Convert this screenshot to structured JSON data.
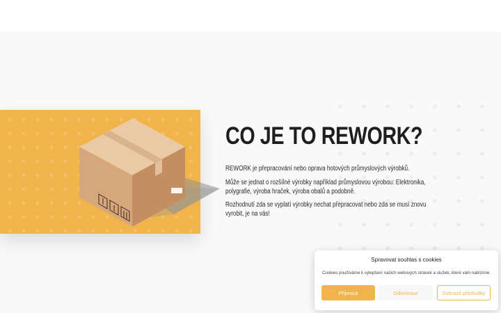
{
  "hero": {
    "heading": "CO JE TO REWORK?",
    "paragraphs": [
      "REWORK je přepracování nebo oprava hotových průmyslových výrobků.",
      "Může se jednat o rozšílné výrobky například průmyslovou výrobou: Elektronika, polygrafie, výroba hraček, výroba obalů a podobně.",
      "Rozhodnutí zda se vyplatí výrobky nechat přepracovat nebo zda se musí znovu vyrobit, je na vás!"
    ],
    "image": {
      "icon": "cardboard-box-icon",
      "background_color": "#f1b44a"
    }
  },
  "cookies": {
    "title": "Spravovat souhlas s cookies",
    "text": "Cookies používáme k vylepšení našich webových stránek a služeb, které vám nabízíme.",
    "accept_label": "Přijmout",
    "deny_label": "Odmítnout",
    "preferences_label": "Zobrazit předvolby",
    "accent_color": "#f1b44a"
  }
}
